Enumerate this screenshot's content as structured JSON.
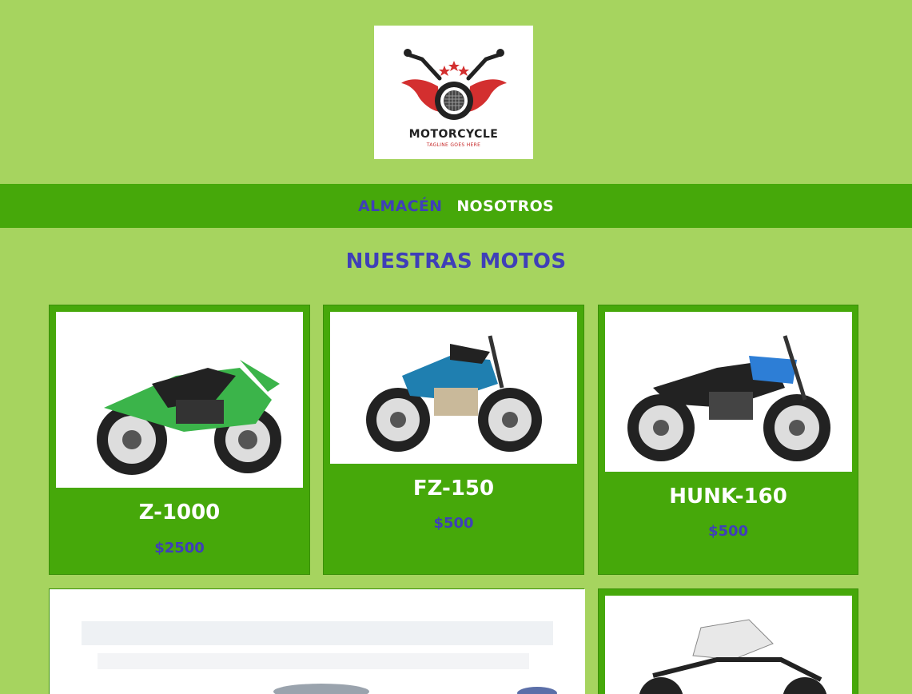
{
  "brand": {
    "name": "MOTORCYCLE",
    "tagline": "TAGLINE GOES HERE"
  },
  "nav": {
    "items": [
      {
        "label": "ALMACÉN",
        "active": true
      },
      {
        "label": "NOSOTROS",
        "active": false
      }
    ]
  },
  "page_title": "NUESTRAS MOTOS",
  "products": [
    {
      "name": "Z-1000",
      "price": "$2500",
      "color": "#3bb44a"
    },
    {
      "name": "FZ-150",
      "price": "$500",
      "color": "#1f7fb0"
    },
    {
      "name": "HUNK-160",
      "price": "$500",
      "color": "#2d7ed6"
    },
    {
      "name": "",
      "price": "",
      "color": "#cfd6de"
    },
    {
      "name": "",
      "price": "",
      "color": "#e8e8e8"
    }
  ],
  "colors": {
    "background": "#a6d45f",
    "nav_bg": "#46a80a",
    "accent": "#3f3fb8"
  }
}
